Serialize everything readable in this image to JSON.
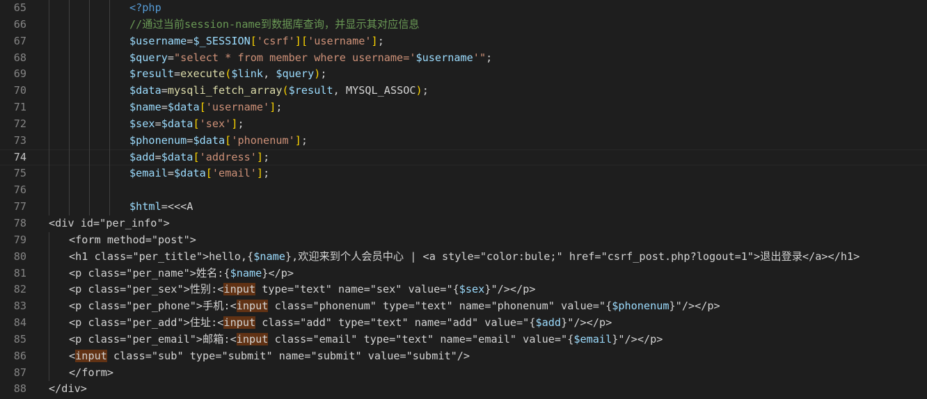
{
  "editor": {
    "active_line": "74",
    "lines": [
      {
        "num": "65",
        "indent": 4,
        "text": "<?php"
      },
      {
        "num": "66",
        "indent": 4,
        "text": "//通过当前session-name到数据库查询，并显示其对应信息"
      },
      {
        "num": "67",
        "indent": 4,
        "text": "$username=$_SESSION['csrf']['username'];"
      },
      {
        "num": "68",
        "indent": 4,
        "text": "$query=\"select * from member where username='$username'\";"
      },
      {
        "num": "69",
        "indent": 4,
        "text": "$result=execute($link, $query);"
      },
      {
        "num": "70",
        "indent": 4,
        "text": "$data=mysqli_fetch_array($result, MYSQL_ASSOC);"
      },
      {
        "num": "71",
        "indent": 4,
        "text": "$name=$data['username'];"
      },
      {
        "num": "72",
        "indent": 4,
        "text": "$sex=$data['sex'];"
      },
      {
        "num": "73",
        "indent": 4,
        "text": "$phonenum=$data['phonenum'];"
      },
      {
        "num": "74",
        "indent": 4,
        "text": "$add=$data['address'];"
      },
      {
        "num": "75",
        "indent": 4,
        "text": "$email=$data['email'];"
      },
      {
        "num": "76",
        "indent": 4,
        "text": ""
      },
      {
        "num": "77",
        "indent": 4,
        "text": "$html=<<<A"
      },
      {
        "num": "78",
        "indent": 0,
        "text": "<div id=\"per_info\">"
      },
      {
        "num": "79",
        "indent": 1,
        "text": "<form method=\"post\">"
      },
      {
        "num": "80",
        "indent": 1,
        "text": "<h1 class=\"per_title\">hello,{$name},欢迎来到个人会员中心 | <a style=\"color:bule;\" href=\"csrf_post.php?logout=1\">退出登录</a></h1>"
      },
      {
        "num": "81",
        "indent": 1,
        "text": "<p class=\"per_name\">姓名:{$name}</p>"
      },
      {
        "num": "82",
        "indent": 1,
        "text": "<p class=\"per_sex\">性别:<input type=\"text\" name=\"sex\" value=\"{$sex}\"/></p>"
      },
      {
        "num": "83",
        "indent": 1,
        "text": "<p class=\"per_phone\">手机:<input class=\"phonenum\" type=\"text\" name=\"phonenum\" value=\"{$phonenum}\"/></p>"
      },
      {
        "num": "84",
        "indent": 1,
        "text": "<p class=\"per_add\">住址:<input class=\"add\" type=\"text\" name=\"add\" value=\"{$add}\"/></p>"
      },
      {
        "num": "85",
        "indent": 1,
        "text": "<p class=\"per_email\">邮箱:<input class=\"email\" type=\"text\" name=\"email\" value=\"{$email}\"/></p>"
      },
      {
        "num": "86",
        "indent": 1,
        "text": "<input class=\"sub\" type=\"submit\" name=\"submit\" value=\"submit\"/>"
      },
      {
        "num": "87",
        "indent": 1,
        "text": "</form>"
      },
      {
        "num": "88",
        "indent": 0,
        "text": "</div>"
      }
    ]
  },
  "colors": {
    "background": "#1e1e1e",
    "line_number": "#858585",
    "variable": "#9cdcfe",
    "string": "#ce9178",
    "function": "#dcdcaa",
    "comment": "#6a9955",
    "keyword": "#569cd6",
    "bracket": "#ffd700",
    "word_highlight": "#613214"
  }
}
